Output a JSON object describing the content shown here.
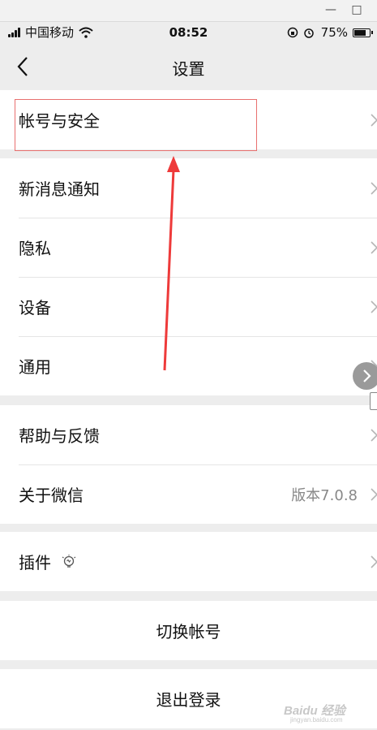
{
  "window": {
    "minimize_glyph": "—",
    "maximize_glyph": "□"
  },
  "status_bar": {
    "carrier": "中国移动",
    "time": "08:52",
    "battery": "75%"
  },
  "nav": {
    "title": "设置",
    "back_icon": "chevron-left-icon"
  },
  "groups": [
    {
      "items": [
        {
          "label": "帐号与安全"
        }
      ]
    },
    {
      "items": [
        {
          "label": "新消息通知"
        },
        {
          "label": "隐私"
        },
        {
          "label": "设备"
        },
        {
          "label": "通用"
        }
      ]
    },
    {
      "items": [
        {
          "label": "帮助与反馈"
        },
        {
          "label": "关于微信",
          "value": "版本7.0.8"
        }
      ]
    },
    {
      "items": [
        {
          "label": "插件",
          "icon": "lightbulb-icon"
        }
      ]
    }
  ],
  "actions": {
    "switch_account": "切换帐号",
    "logout": "退出登录"
  },
  "annotation": {
    "color": "#e8706f",
    "arrow_color": "#ee3a3a"
  },
  "watermark": {
    "text": "Baidu 经验",
    "sub": "jingyan.baidu.com"
  }
}
